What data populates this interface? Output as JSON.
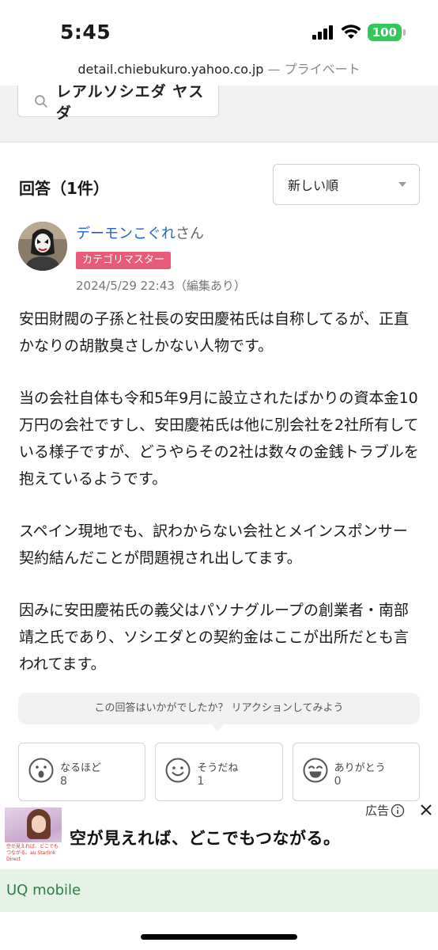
{
  "status": {
    "time": "5:45",
    "battery": "100"
  },
  "browser": {
    "host": "detail.chiebukuro.yahoo.co.jp",
    "separator": "—",
    "mode": "プライベート"
  },
  "search": {
    "query": "レアルソシエダ ヤスダ",
    "icon": "search-icon"
  },
  "answers": {
    "title": "回答（1件）",
    "sort": {
      "selected": "新しい順"
    }
  },
  "answer": {
    "author_name": "デーモンこぐれ",
    "author_suffix": "さん",
    "badge": "カテゴリマスター",
    "timestamp": "2024/5/29 22:43（編集あり）",
    "paragraphs": [
      "安田財閥の子孫と社長の安田慶祐氏は自称してるが、正直かなりの胡散臭さしかない人物です。",
      "当の会社自体も令和5年9月に設立されたばかりの資本金10万円の会社ですし、安田慶祐氏は他に別会社を2社所有している様子ですが、どうやらその2社は数々の金銭トラブルを抱えているようです。",
      "スペイン現地でも、訳わからない会社とメインスポンサー契約結んだことが問題視され出してます。",
      "因みに安田慶祐氏の義父はパソナグループの創業者・南部靖之氏であり、ソシエダとの契約金はここが出所だとも言われてます。"
    ]
  },
  "reactions": {
    "prompt": "この回答はいかがでしたか？ リアクションしてみよう",
    "items": [
      {
        "label": "なるほど",
        "count": "8",
        "icon": "surprised-face-icon"
      },
      {
        "label": "そうだね",
        "count": "1",
        "icon": "smile-face-icon"
      },
      {
        "label": "ありがとう",
        "count": "0",
        "icon": "grin-face-icon"
      }
    ]
  },
  "ad": {
    "label": "広告",
    "headline": "空が見えれば、どこでもつながる。",
    "brand": "UQ mobile",
    "thumb_text": "空が見えれば、どこでもつながる。au Starlink Direct"
  },
  "colors": {
    "badge": "#e85b78",
    "author_link": "#1e66c8",
    "battery": "#34c759",
    "ad_bar": "#e4f3e5"
  }
}
